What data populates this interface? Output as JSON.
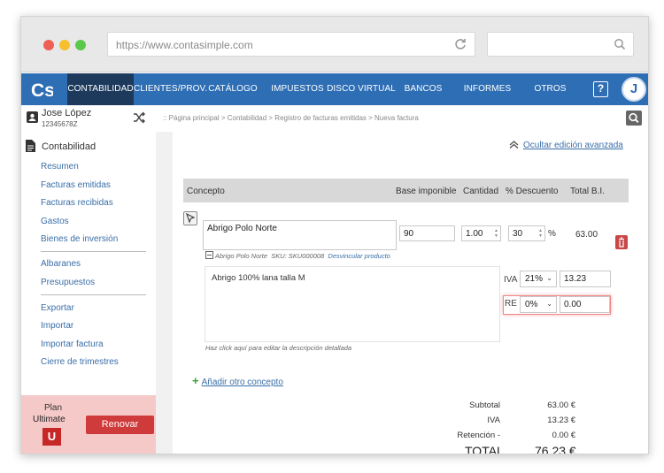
{
  "browser": {
    "url": "https://www.contasimple.com",
    "traffic_light_colors": [
      "#ee5e52",
      "#f5bf2d",
      "#5ac84b"
    ]
  },
  "nav": {
    "logo": "Cs",
    "items": [
      {
        "label": "CONTABILIDAD",
        "active": true
      },
      {
        "label": "CLIENTES/PROV.",
        "active": false
      },
      {
        "label": "CATÁLOGO",
        "active": false
      },
      {
        "label": "IMPUESTOS",
        "active": false
      },
      {
        "label": "DISCO VIRTUAL",
        "active": false
      },
      {
        "label": "BANCOS",
        "active": false
      },
      {
        "label": "INFORMES",
        "active": false
      },
      {
        "label": "OTROS",
        "active": false
      }
    ],
    "help": "?",
    "avatar": "J",
    "brand_color": "#2e6eb5",
    "active_color": "#1d3a5c"
  },
  "user": {
    "name": "Jose López",
    "id": "12345678Z"
  },
  "breadcrumb": ":: Página principal > Contabilidad > Registro de facturas emitidas > Nueva factura",
  "sidebar": {
    "section": "Contabilidad",
    "group1": [
      "Resumen",
      "Facturas emitidas",
      "Facturas recibidas",
      "Gastos",
      "Bienes de inversión"
    ],
    "group2": [
      "Albaranes",
      "Presupuestos"
    ],
    "group3": [
      "Exportar",
      "Importar",
      "Importar factura",
      "Cierre de trimestres"
    ],
    "plan": {
      "line1": "Plan",
      "line2": "Ultimate",
      "logo": "U",
      "renew": "Renovar"
    }
  },
  "editor": {
    "advanced_toggle": "Ocultar edición avanzada",
    "columns": [
      "Concepto",
      "Base imponible",
      "Cantidad",
      "% Descuento",
      "Total B.I."
    ],
    "row": {
      "concept": "Abrigo Polo Norte",
      "base": "90",
      "quantity": "1.00",
      "discount": "30",
      "percent_sign": "%",
      "total": "63.00",
      "product_name": "Abrigo Polo Norte",
      "sku": "SKU: SKU000008",
      "unlink": "Desvincular producto",
      "description": "Abrigo 100% lana talla M",
      "description_hint": "Haz click aquí para editar la descripción detallada",
      "iva_label": "IVA",
      "iva_rate": "21%",
      "iva_amount": "13.23",
      "re_label": "RE",
      "re_rate": "0%",
      "re_amount": "0.00"
    },
    "add_concept": "Añadir otro concepto"
  },
  "summary": {
    "subtotal_label": "Subtotal",
    "subtotal": "63.00 €",
    "iva_label": "IVA",
    "iva": "13.23 €",
    "retention_label": "Retención -",
    "retention": "0.00 €",
    "total_label": "TOTAL",
    "total": "76.23 €"
  }
}
